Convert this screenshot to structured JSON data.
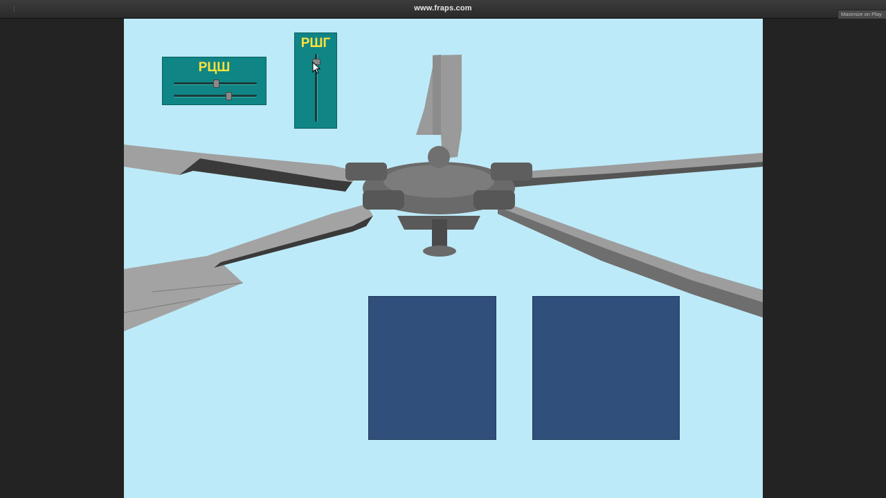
{
  "window": {
    "title": "www.fraps.com",
    "maximize_label": "Maximize on Play",
    "handle_glyph": "⋮"
  },
  "controls": {
    "rcsh": {
      "label": "РЦШ",
      "slider_1_value": 0.5,
      "slider_2_value": 0.65
    },
    "rshg": {
      "label": "РШГ",
      "slider_value": 0.9
    }
  },
  "icons": {
    "cursor": "mouse-pointer-icon"
  },
  "colors": {
    "sky": "#bdeaf8",
    "panel": "#0f8585",
    "panel_label": "#ffe13a",
    "view_box": "#304f7b",
    "metal": "#8c8c8c"
  }
}
